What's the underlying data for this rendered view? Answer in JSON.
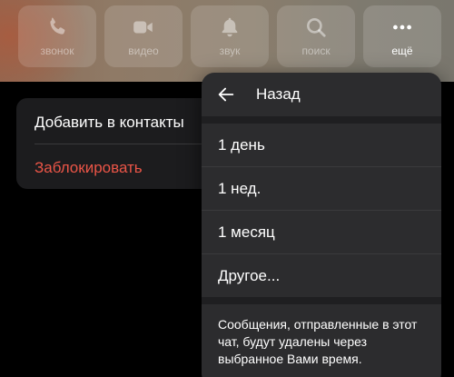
{
  "actions": [
    {
      "label": "звонок",
      "icon": "phone-icon"
    },
    {
      "label": "видео",
      "icon": "video-icon"
    },
    {
      "label": "звук",
      "icon": "bell-icon"
    },
    {
      "label": "поиск",
      "icon": "search-icon"
    },
    {
      "label": "ещё",
      "icon": "more-icon"
    }
  ],
  "contact_menu": {
    "add_label": "Добавить в контакты",
    "block_label": "Заблокировать",
    "block_color": "#eb5547"
  },
  "auto_delete_menu": {
    "back_label": "Назад",
    "options": [
      "1 день",
      "1 нед.",
      "1 месяц",
      "Другое..."
    ],
    "note": "Сообщения, отправленные в этот чат, будут удалены через выбранное Вами время."
  }
}
